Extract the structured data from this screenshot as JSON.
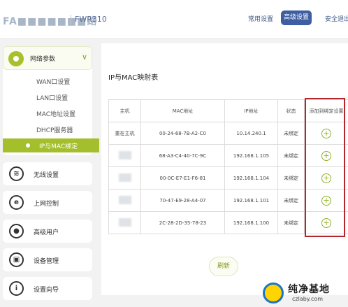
{
  "header": {
    "brand": "FA■■■■■■■路",
    "model": "FWR310",
    "nav_common": "常用设置",
    "nav_advanced": "高级设置",
    "nav_security": "安全退出"
  },
  "sidebar": {
    "group_label": "网络参数",
    "sub_items": [
      "WAN口设置",
      "LAN口设置",
      "MAC地址设置",
      "DHCP服务器"
    ],
    "active_item": "IP与MAC绑定",
    "menu_items": [
      {
        "icon": "wifi-icon",
        "label": "无线设置"
      },
      {
        "icon": "internet-icon",
        "label": "上网控制"
      },
      {
        "icon": "user-icon",
        "label": "高级用户"
      },
      {
        "icon": "device-icon",
        "label": "设备管理"
      },
      {
        "icon": "info-icon",
        "label": "设置向导"
      }
    ]
  },
  "main": {
    "title": "IP与MAC映射表",
    "table": {
      "headers": [
        "主机",
        "MAC地址",
        "IP地址",
        "状态",
        "添加到绑定设置"
      ],
      "rows": [
        {
          "host": "重在主机",
          "mac": "00-24-68-7B-A2-C0",
          "ip": "10.14.240.1",
          "status": "未绑定"
        },
        {
          "host": "",
          "mac": "68-A3-C4-40-7C-9C",
          "ip": "192.168.1.105",
          "status": "未绑定"
        },
        {
          "host": "",
          "mac": "00-0C-E7-E1-F6-81",
          "ip": "192.168.1.104",
          "status": "未绑定"
        },
        {
          "host": "",
          "mac": "70-47-E9-28-A4-07",
          "ip": "192.168.1.101",
          "status": "未绑定"
        },
        {
          "host": "",
          "mac": "2C-28-2D-35-78-23",
          "ip": "192.168.1.100",
          "status": "未绑定"
        }
      ]
    },
    "refresh_label": "刷新"
  },
  "watermark": {
    "name": "纯净基地",
    "url": "czlaby.com"
  }
}
